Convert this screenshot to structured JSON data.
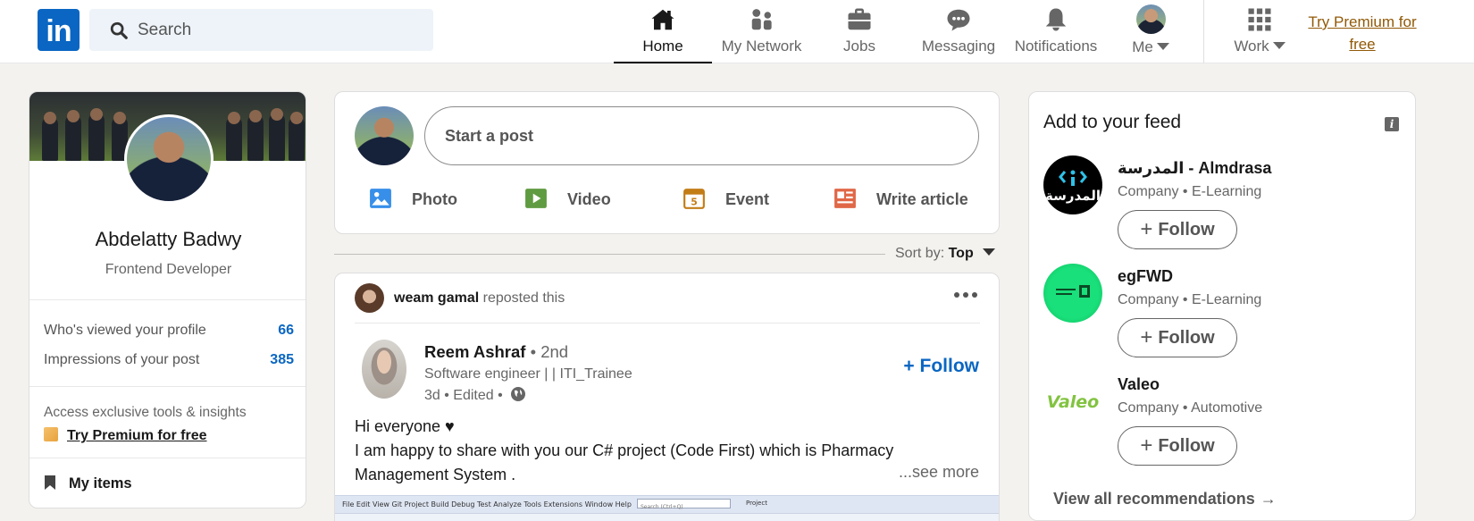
{
  "header": {
    "logo_text": "in",
    "search_placeholder": "Search",
    "nav": [
      {
        "label": "Home",
        "icon": "home-icon"
      },
      {
        "label": "My Network",
        "icon": "network-icon"
      },
      {
        "label": "Jobs",
        "icon": "briefcase-icon"
      },
      {
        "label": "Messaging",
        "icon": "messaging-icon"
      },
      {
        "label": "Notifications",
        "icon": "bell-icon"
      },
      {
        "label": "Me",
        "icon": "avatar"
      },
      {
        "label": "Work",
        "icon": "grid-icon"
      }
    ],
    "premium_line1": "Try Premium for",
    "premium_line2": "free",
    "premium_color": "#915907"
  },
  "profile": {
    "name": "Abdelatty Badwy",
    "headline": "Frontend Developer",
    "stats": [
      {
        "label": "Who's viewed your profile",
        "value": "66"
      },
      {
        "label": "Impressions of your post",
        "value": "385"
      }
    ],
    "access_text": "Access exclusive tools & insights",
    "try_premium": "Try Premium for free",
    "my_items": "My items"
  },
  "share": {
    "placeholder": "Start a post",
    "actions": [
      {
        "label": "Photo",
        "icon": "photo-icon",
        "color": "#378fe9"
      },
      {
        "label": "Video",
        "icon": "video-icon",
        "color": "#5f9b41"
      },
      {
        "label": "Event",
        "icon": "calendar-icon",
        "color": "#c37d16"
      },
      {
        "label": "Write article",
        "icon": "article-icon",
        "color": "#e06847"
      }
    ]
  },
  "sort": {
    "label": "Sort by:",
    "value": "Top"
  },
  "post": {
    "reposter": "weam gamal",
    "repost_text": "reposted this",
    "author": "Reem Ashraf",
    "degree": "• 2nd",
    "headline": "Software engineer | | ITI_Trainee",
    "meta": "3d • Edited •",
    "follow": "+ Follow",
    "body_line1": "Hi everyone ♥",
    "body_line2": "I am happy to share with you our C# project (Code First) which is Pharmacy",
    "body_line3": "Management System .",
    "see_more": "...see more",
    "vs_menu": "File   Edit   View   Git   Project   Build   Debug   Test   Analyze   Tools   Extensions   Window   Help",
    "vs_search": "Search (Ctrl+Q)",
    "vs_project": "Project"
  },
  "feed": {
    "title": "Add to your feed",
    "recommendations": [
      {
        "name": "المدرسة - Almdrasa",
        "sub": "Company • E-Learning",
        "follow": "Follow",
        "logo_color": "#000000"
      },
      {
        "name": "egFWD",
        "sub": "Company • E-Learning",
        "follow": "Follow",
        "logo_color": "#12d36d"
      },
      {
        "name": "Valeo",
        "sub": "Company • Automotive",
        "follow": "Follow",
        "logo_color": "#82c341"
      }
    ],
    "view_all": "View all recommendations",
    "view_all_arrow": "→"
  },
  "colors": {
    "accent": "#0a66c2",
    "background": "#f4f2ee"
  }
}
